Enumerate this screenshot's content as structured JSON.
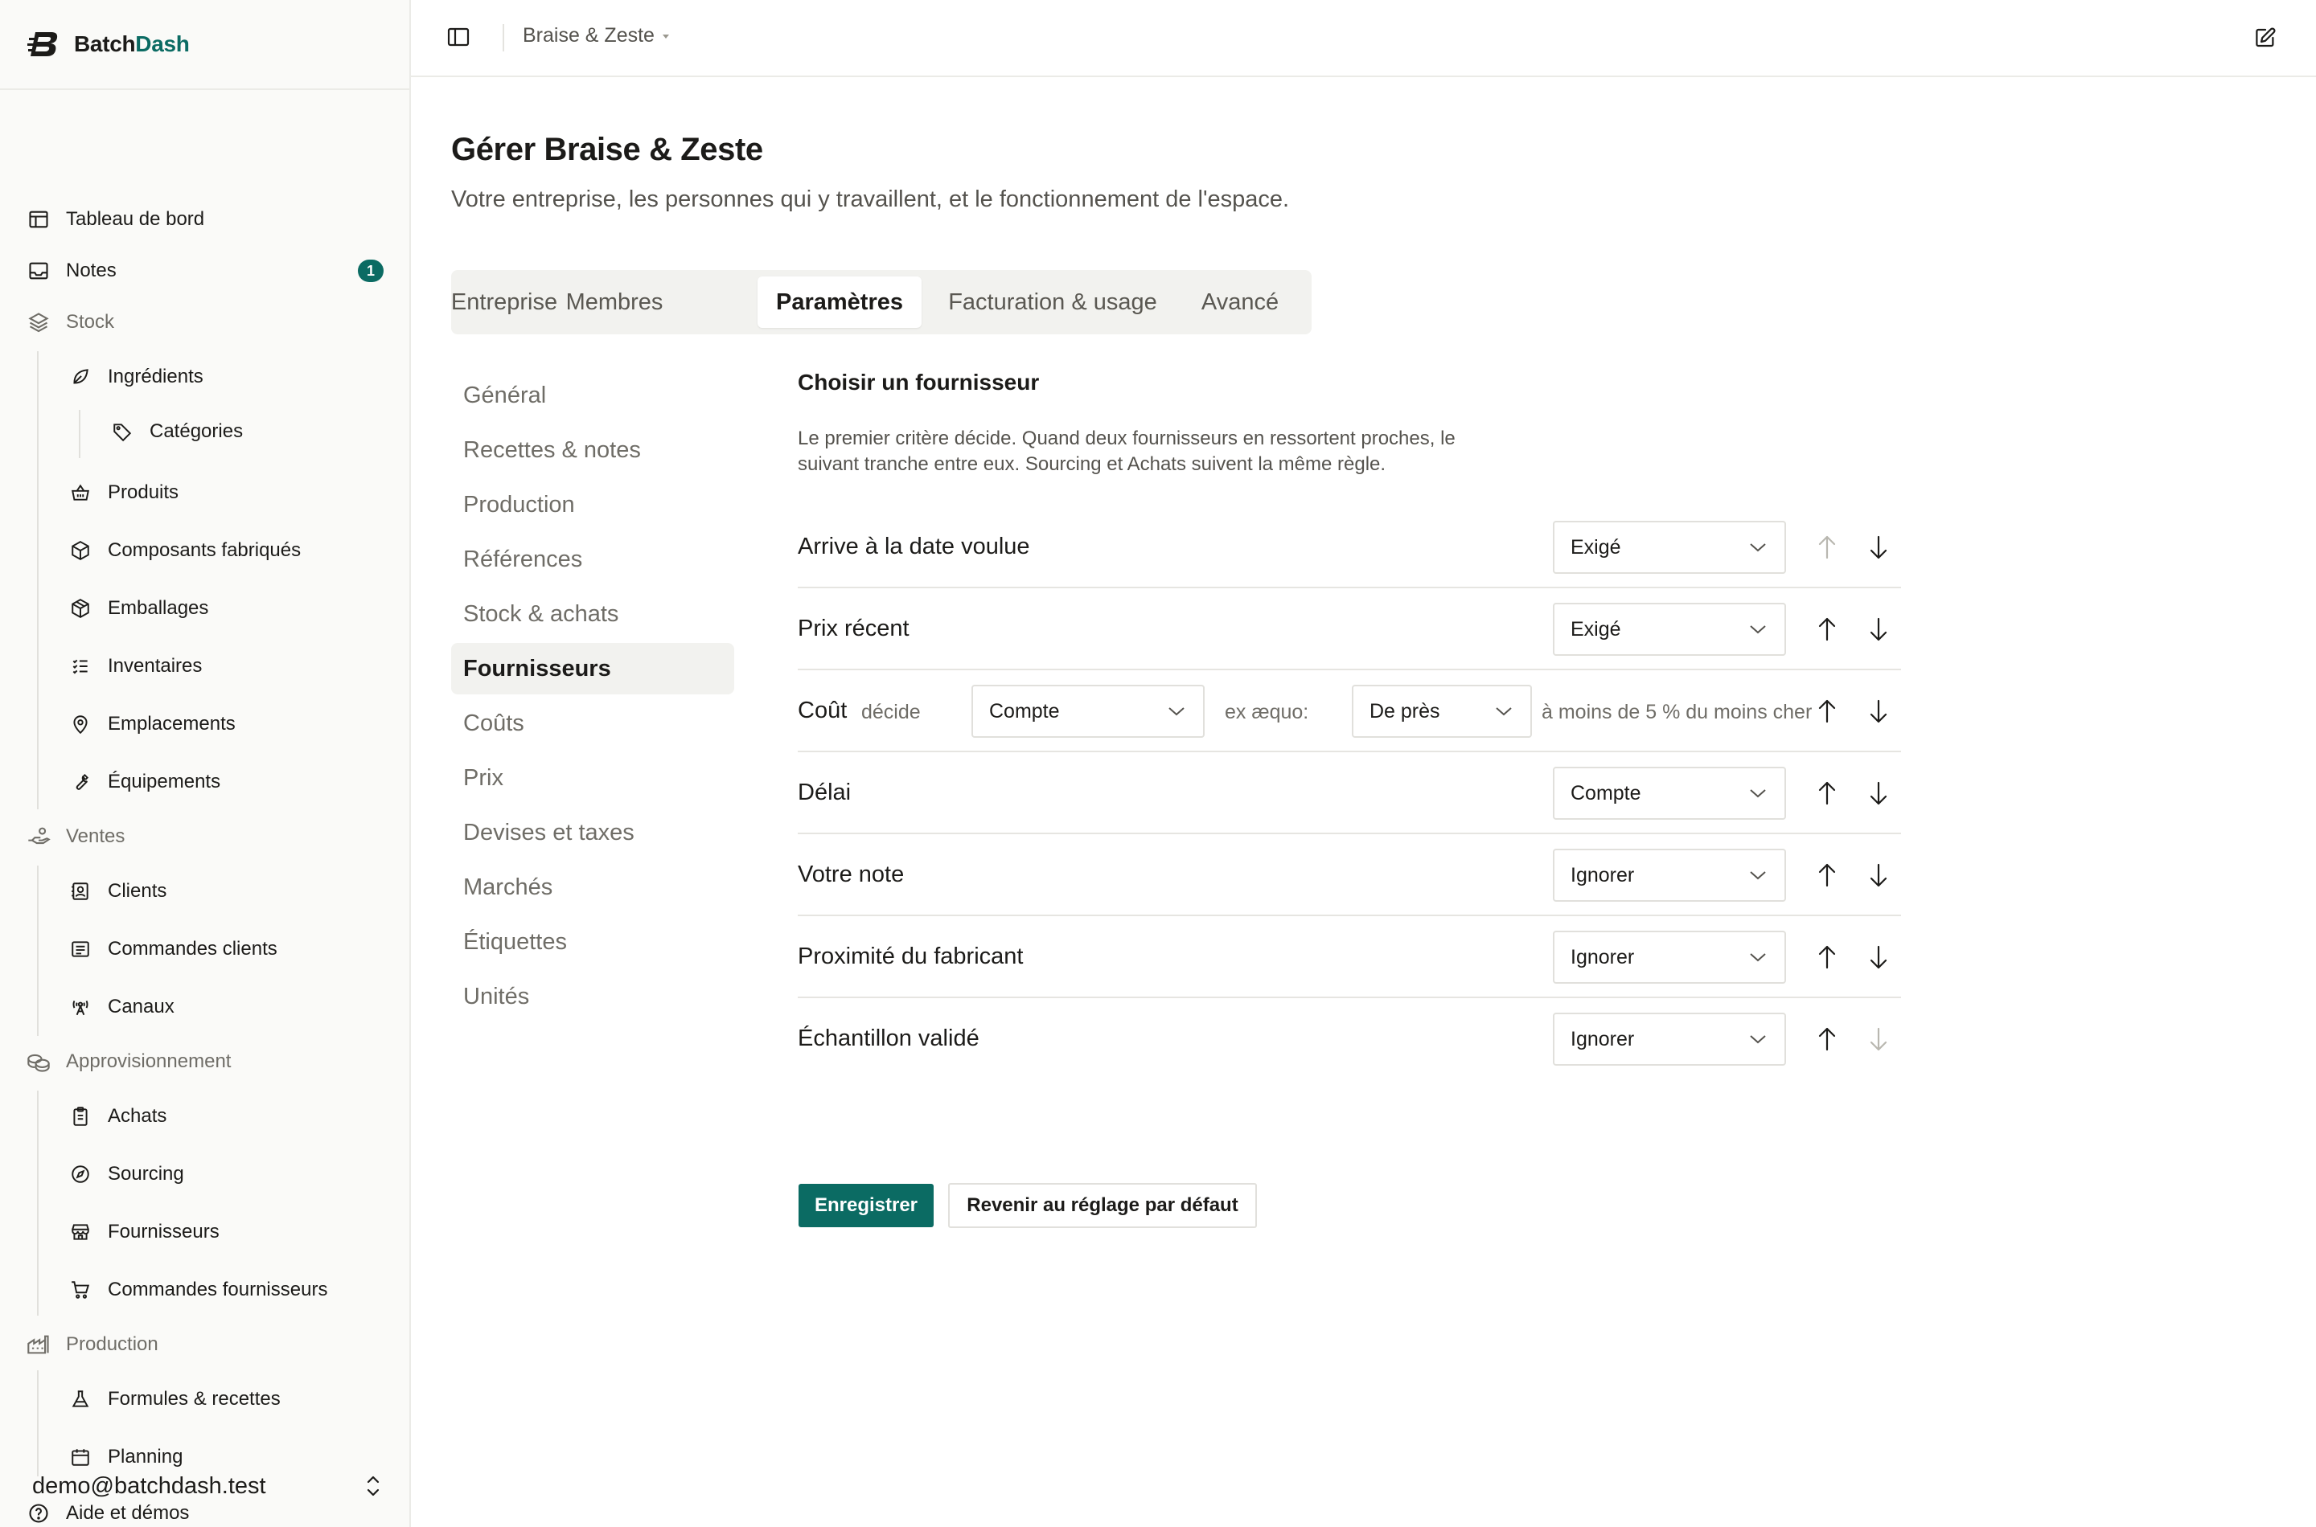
{
  "brand": {
    "name_part1": "Batch",
    "name_part2": "Dash",
    "accent_color": "#0b6b63"
  },
  "sidebar": {
    "items": [
      {
        "label": "Tableau de bord",
        "icon": "dashboard-icon"
      },
      {
        "label": "Notes",
        "icon": "inbox-icon",
        "badge": "1"
      },
      {
        "label": "Stock",
        "icon": "layers-icon"
      },
      {
        "label": "Ingrédients",
        "icon": "leaf-icon"
      },
      {
        "label": "Catégories",
        "icon": "tag-icon"
      },
      {
        "label": "Produits",
        "icon": "basket-icon"
      },
      {
        "label": "Composants fabriqués",
        "icon": "cube-icon"
      },
      {
        "label": "Emballages",
        "icon": "package-icon"
      },
      {
        "label": "Inventaires",
        "icon": "checklist-icon"
      },
      {
        "label": "Emplacements",
        "icon": "map-pin-icon"
      },
      {
        "label": "Équipements",
        "icon": "wrench-icon"
      },
      {
        "label": "Ventes",
        "icon": "hand-coins-icon"
      },
      {
        "label": "Clients",
        "icon": "contact-icon"
      },
      {
        "label": "Commandes clients",
        "icon": "receipt-icon"
      },
      {
        "label": "Canaux",
        "icon": "radio-tower-icon"
      },
      {
        "label": "Approvisionnement",
        "icon": "coins-icon"
      },
      {
        "label": "Achats",
        "icon": "clipboard-icon"
      },
      {
        "label": "Sourcing",
        "icon": "compass-icon"
      },
      {
        "label": "Fournisseurs",
        "icon": "store-icon"
      },
      {
        "label": "Commandes fournisseurs",
        "icon": "cart-icon"
      },
      {
        "label": "Production",
        "icon": "factory-icon"
      },
      {
        "label": "Formules & recettes",
        "icon": "flask-icon"
      },
      {
        "label": "Planning",
        "icon": "calendar-icon"
      },
      {
        "label": "Aide et démos",
        "icon": "help-circle-icon"
      }
    ],
    "user_email": "demo@batchdash.test"
  },
  "topbar": {
    "breadcrumb": "Braise & Zeste"
  },
  "page": {
    "title": "Gérer Braise & Zeste",
    "subtitle": "Votre entreprise, les personnes qui y travaillent, et le fonctionnement de l'espace."
  },
  "tabs": [
    {
      "label": "Entreprise"
    },
    {
      "label": "Membres"
    },
    {
      "label": "Paramètres",
      "active": true
    },
    {
      "label": "Facturation & usage"
    },
    {
      "label": "Avancé"
    }
  ],
  "subnav": [
    {
      "label": "Général"
    },
    {
      "label": "Recettes & notes"
    },
    {
      "label": "Production"
    },
    {
      "label": "Références"
    },
    {
      "label": "Stock & achats"
    },
    {
      "label": "Fournisseurs",
      "active": true
    },
    {
      "label": "Coûts"
    },
    {
      "label": "Prix"
    },
    {
      "label": "Devises et taxes"
    },
    {
      "label": "Marchés"
    },
    {
      "label": "Étiquettes"
    },
    {
      "label": "Unités"
    }
  ],
  "panel": {
    "title": "Choisir un fournisseur",
    "desc_line1": "Le premier critère décide. Quand deux fournisseurs en ressortent proches, le",
    "desc_line2": "suivant tranche entre eux. Sourcing et Achats suivent la même règle.",
    "criteria": [
      {
        "name": "Arrive à la date voulue",
        "value": "Exigé",
        "up_enabled": false,
        "down_enabled": true
      },
      {
        "name": "Prix récent",
        "value": "Exigé",
        "up_enabled": true,
        "down_enabled": true
      },
      {
        "name": "Coût",
        "decides_label": "décide",
        "value": "Compte",
        "tie_label": "ex æquo:",
        "tie_value": "De près",
        "tie_note": "à moins de 5 % du moins cher",
        "up_enabled": true,
        "down_enabled": true
      },
      {
        "name": "Délai",
        "value": "Compte",
        "up_enabled": true,
        "down_enabled": true
      },
      {
        "name": "Votre note",
        "value": "Ignorer",
        "up_enabled": true,
        "down_enabled": true
      },
      {
        "name": "Proximité du fabricant",
        "value": "Ignorer",
        "up_enabled": true,
        "down_enabled": true
      },
      {
        "name": "Échantillon validé",
        "value": "Ignorer",
        "up_enabled": true,
        "down_enabled": false
      }
    ],
    "save_label": "Enregistrer",
    "reset_label": "Revenir au réglage par défaut"
  }
}
